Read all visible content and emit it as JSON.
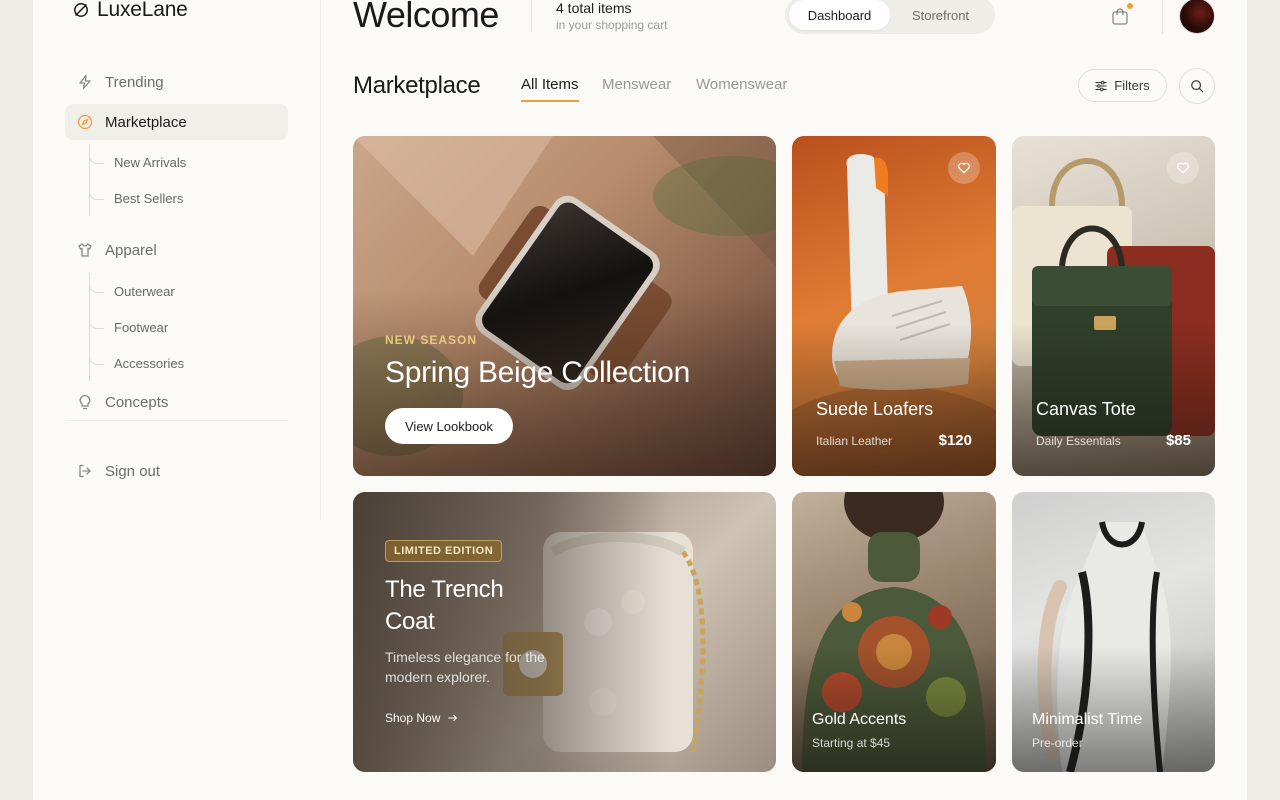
{
  "app": {
    "name": "LuxeLane"
  },
  "sidebar": {
    "items": [
      {
        "label": "Trending",
        "icon": "lightning-icon"
      },
      {
        "label": "Marketplace",
        "icon": "compass-icon",
        "active": true
      },
      {
        "label": "Apparel",
        "icon": "shirt-icon"
      },
      {
        "label": "Concepts",
        "icon": "lightbulb-icon"
      }
    ],
    "marketplace_sub": [
      "New Arrivals",
      "Best Sellers"
    ],
    "apparel_sub": [
      "Outerwear",
      "Footwear",
      "Accessories"
    ],
    "signout": "Sign out"
  },
  "header": {
    "welcome": "Welcome",
    "cart_count": "4 total items",
    "cart_sub": "in your shopping cart",
    "segments": [
      "Dashboard",
      "Storefront"
    ],
    "active_segment": "Dashboard"
  },
  "marketplace": {
    "title": "Marketplace",
    "tabs": [
      "All Items",
      "Menswear",
      "Womenswear"
    ],
    "active_tab": "All Items",
    "filters_label": "Filters"
  },
  "cards": {
    "hero": {
      "eyebrow": "NEW SEASON",
      "title": "Spring Beige Collection",
      "button": "View Lookbook"
    },
    "loafers": {
      "name": "Suede Loafers",
      "sub": "Italian Leather",
      "price": "$120"
    },
    "tote": {
      "name": "Canvas Tote",
      "sub": "Daily Essentials",
      "price": "$85"
    },
    "trench": {
      "badge": "LIMITED EDITION",
      "title_line1": "The Trench",
      "title_line2": "Coat",
      "desc_line1": "Timeless elegance for the",
      "desc_line2": "modern explorer.",
      "link": "Shop Now"
    },
    "gold": {
      "name": "Gold Accents",
      "sub": "Starting at $45"
    },
    "minimal": {
      "name": "Minimalist Time",
      "sub": "Pre-order"
    }
  },
  "colors": {
    "accent": "#f0a03a",
    "background": "#fbfaf7",
    "gold_text": "#e8c97d"
  }
}
